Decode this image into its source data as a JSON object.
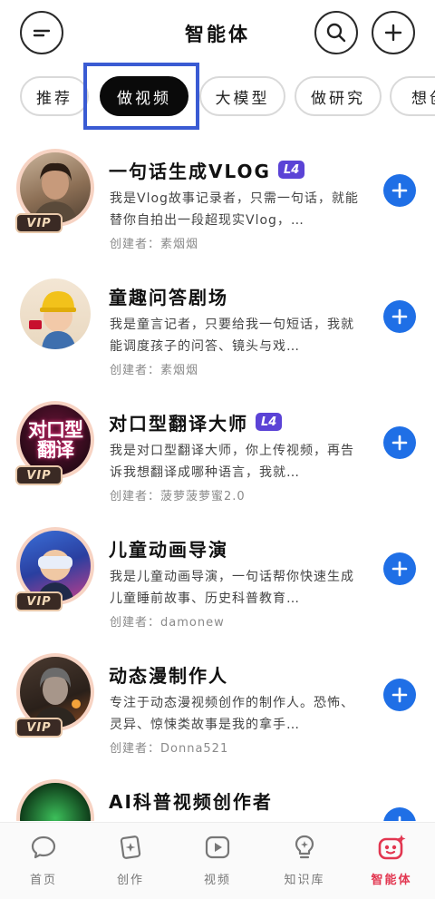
{
  "header": {
    "title": "智能体",
    "menu_icon": "minus-icon",
    "search_icon": "search-icon",
    "add_icon": "plus-icon"
  },
  "tabs": [
    {
      "label": "推荐",
      "active": false
    },
    {
      "label": "做视频",
      "active": true
    },
    {
      "label": "大模型",
      "active": false
    },
    {
      "label": "做研究",
      "active": false
    },
    {
      "label": "想创",
      "active": false
    }
  ],
  "agents": [
    {
      "name": "一句话生成VLOG",
      "badge": "L4",
      "vip": "VIP",
      "description": "我是Vlog故事记录者，只需一句话，就能替你自拍出一段超现实Vlog，…",
      "creator": "创建者：素烟烟"
    },
    {
      "name": "童趣问答剧场",
      "badge": "",
      "vip": "",
      "description": "我是童言记者，只要给我一句短话，我就能调度孩子的问答、镜头与戏…",
      "creator": "创建者：素烟烟"
    },
    {
      "name": "对口型翻译大师",
      "badge": "L4",
      "vip": "VIP",
      "avatar_text": "对口型翻译",
      "description": "我是对口型翻译大师，你上传视频，再告诉我想翻译成哪种语言，我就…",
      "creator": "创建者：菠萝菠萝蜜2.0"
    },
    {
      "name": "儿童动画导演",
      "badge": "",
      "vip": "VIP",
      "description": "我是儿童动画导演，一句话帮你快速生成儿童睡前故事、历史科普教育…",
      "creator": "创建者：damonew"
    },
    {
      "name": "动态漫制作人",
      "badge": "",
      "vip": "VIP",
      "description": "专注于动态漫视频创作的制作人。恐怖、灵异、惊悚类故事是我的拿手…",
      "creator": "创建者：Donna521"
    },
    {
      "name": "AI科普视频创作者",
      "badge": "",
      "vip": "",
      "description": "",
      "creator": ""
    }
  ],
  "bottom_nav": [
    {
      "label": "首页",
      "icon": "chat-bubble-icon",
      "active": false
    },
    {
      "label": "创作",
      "icon": "create-sparkle-icon",
      "active": false
    },
    {
      "label": "视频",
      "icon": "play-video-icon",
      "active": false
    },
    {
      "label": "知识库",
      "icon": "lightbulb-icon",
      "active": false
    },
    {
      "label": "智能体",
      "icon": "agent-robot-icon",
      "active": true
    }
  ],
  "colors": {
    "accent_blue": "#1f6fe6",
    "badge_purple": "#5b43d6",
    "active_nav": "#e23650",
    "focus_outline": "#3a5bd3"
  }
}
